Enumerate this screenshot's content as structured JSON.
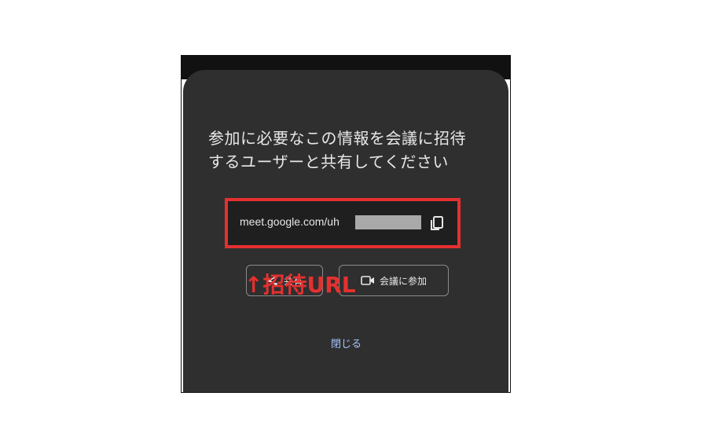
{
  "dialog": {
    "title_line1": "参加に必要なこの情報を会議に招待",
    "title_line2": "するユーザーと共有してください",
    "meeting_url": "meet.google.com/uh",
    "share_label": "共有",
    "join_label": "会議に参加",
    "close_label": "閉じる"
  },
  "annotation": {
    "text": "↑招待URL"
  },
  "colors": {
    "dialog_bg": "#2f2f2f",
    "url_box_bg": "#1f1f1f",
    "highlight": "#e53030",
    "link": "#a8c4ff"
  }
}
